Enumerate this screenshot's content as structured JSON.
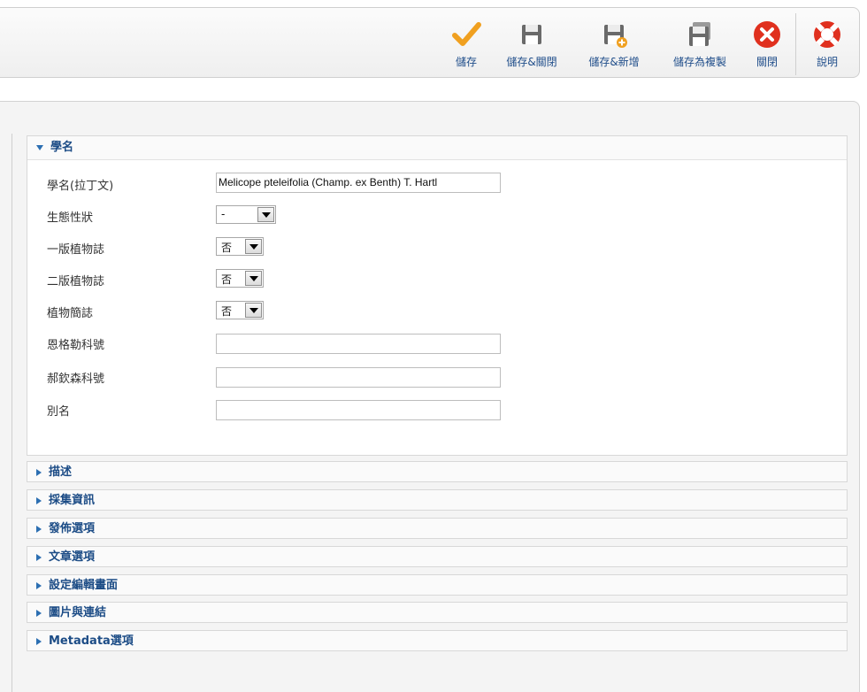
{
  "toolbar": {
    "buttons": [
      {
        "label": "儲存",
        "icon": "checkmark-icon"
      },
      {
        "label": "儲存&關閉",
        "icon": "save-close-icon"
      },
      {
        "label": "儲存&新增",
        "icon": "save-new-icon"
      },
      {
        "label": "儲存為複製",
        "icon": "save-copy-icon"
      },
      {
        "label": "關閉",
        "icon": "close-icon"
      },
      {
        "label": "說明",
        "icon": "help-lifebuoy-icon"
      }
    ]
  },
  "colors": {
    "link": "#1f4d8a",
    "pane_header": "#1c4c86",
    "close_red": "#e0301e",
    "check_orange": "#f0a020"
  },
  "sections": {
    "open": {
      "title": "學名",
      "fields": [
        {
          "label": "學名(拉丁文)",
          "type": "text",
          "value": "Melicope pteleifolia (Champ. ex Benth) T. Hartl"
        },
        {
          "label": "生態性狀",
          "type": "select",
          "value": "-"
        },
        {
          "label": "一版植物誌",
          "type": "select",
          "value": "否"
        },
        {
          "label": "二版植物誌",
          "type": "select",
          "value": "否"
        },
        {
          "label": "植物簡誌",
          "type": "select",
          "value": "否"
        },
        {
          "label": "恩格勒科號",
          "type": "text",
          "value": ""
        },
        {
          "label": "郝欽森科號",
          "type": "text",
          "value": ""
        },
        {
          "label": "別名",
          "type": "text",
          "value": ""
        }
      ]
    },
    "collapsed": [
      "描述",
      "採集資訊",
      "發佈選項",
      "文章選項",
      "設定編輯畫面",
      "圖片與連結",
      "Metadata選項"
    ]
  }
}
